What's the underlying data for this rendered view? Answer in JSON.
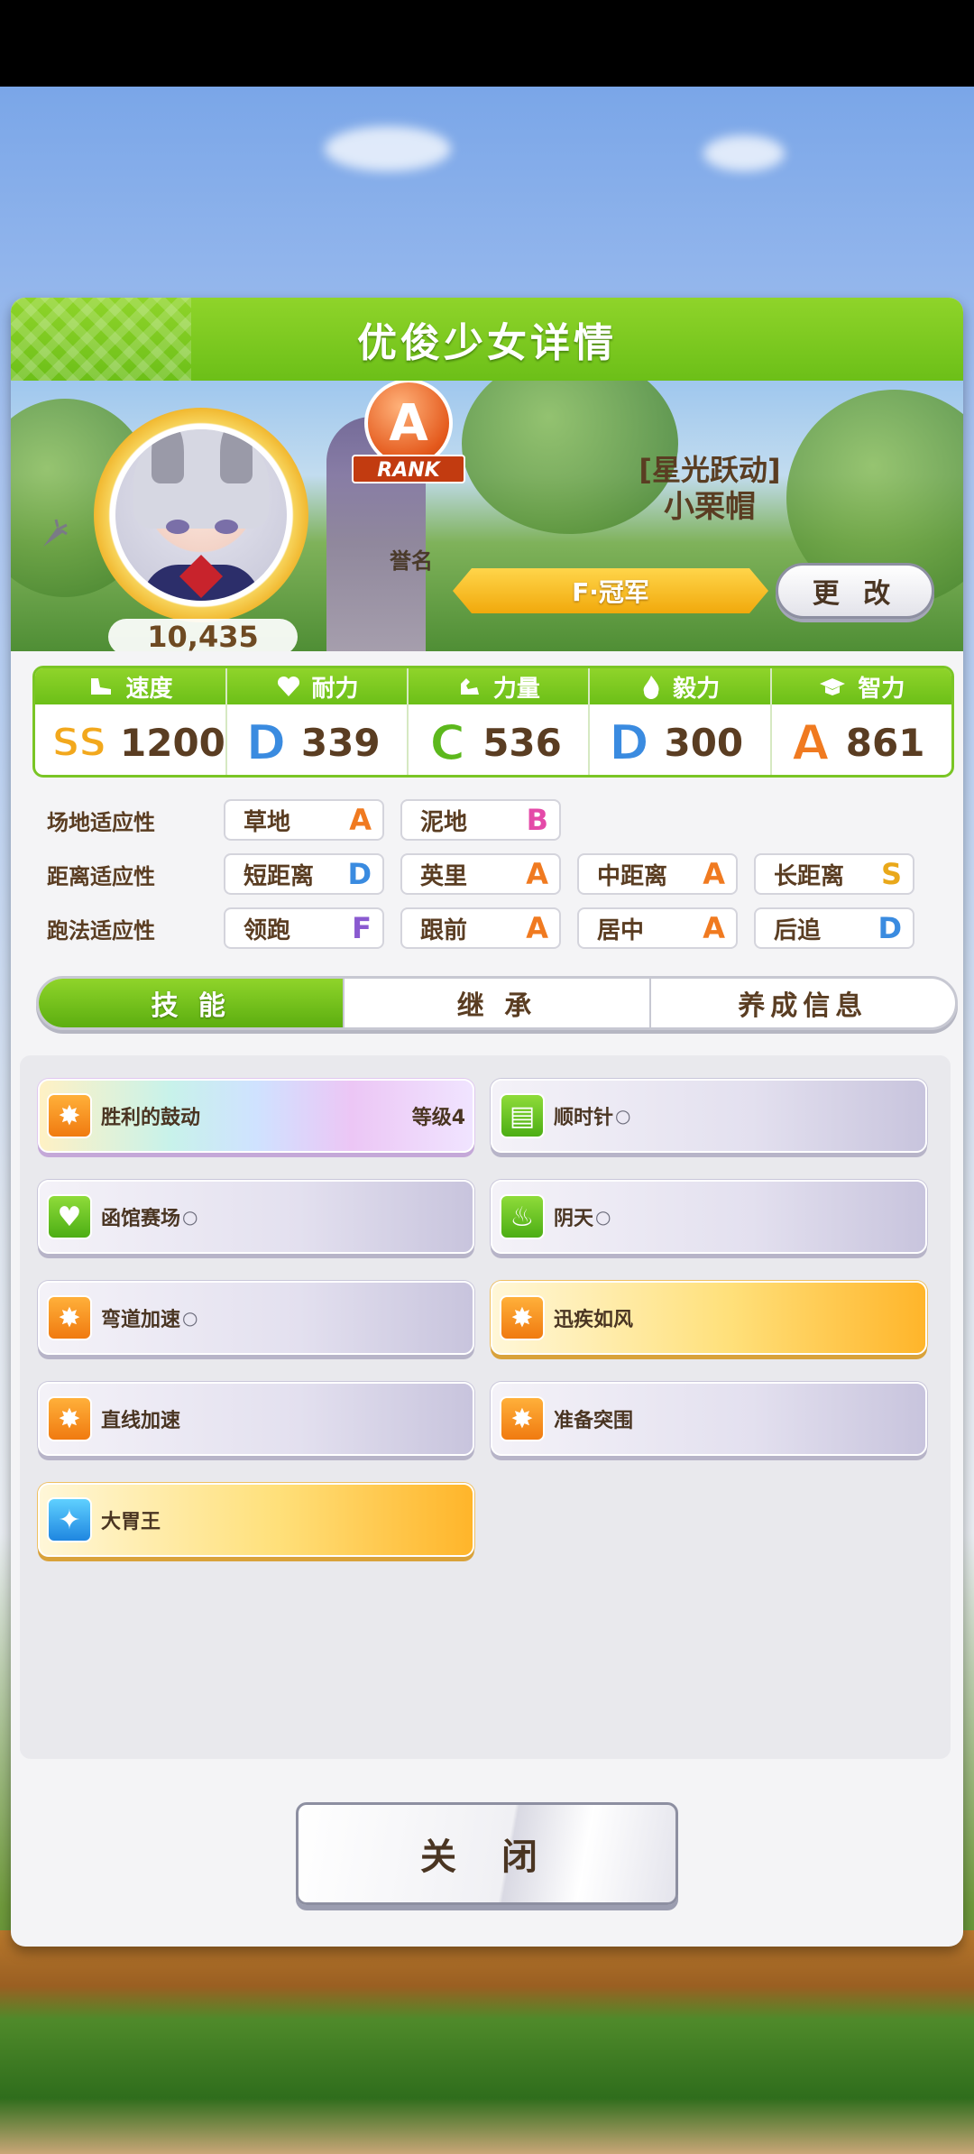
{
  "panel": {
    "title": "优俊少女详情"
  },
  "character": {
    "fans": "10,435",
    "outfit": "[星光跃动]",
    "name": "小栗帽",
    "rank_letter": "A",
    "rank_ribbon": "RANK",
    "rank_caption": "誉名",
    "title": "F·冠军",
    "change_button": "更 改"
  },
  "stats": [
    {
      "name": "速度",
      "grade": "SS",
      "grade_color": "#f2a81d",
      "value": "1200",
      "icon": "shoe-icon"
    },
    {
      "name": "耐力",
      "grade": "D",
      "grade_color": "#3a8be0",
      "value": "339",
      "icon": "heart-icon"
    },
    {
      "name": "力量",
      "grade": "C",
      "grade_color": "#5cb81c",
      "value": "536",
      "icon": "arm-icon"
    },
    {
      "name": "毅力",
      "grade": "D",
      "grade_color": "#3a8be0",
      "value": "300",
      "icon": "flame-icon"
    },
    {
      "name": "智力",
      "grade": "A",
      "grade_color": "#f07a20",
      "value": "861",
      "icon": "cap-icon"
    }
  ],
  "aptitudes": [
    {
      "label": "场地适应性",
      "items": [
        {
          "name": "草地",
          "grade": "A",
          "color": "#f07a20"
        },
        {
          "name": "泥地",
          "grade": "B",
          "color": "#e44aa8"
        }
      ]
    },
    {
      "label": "距离适应性",
      "items": [
        {
          "name": "短距离",
          "grade": "D",
          "color": "#3a8be0"
        },
        {
          "name": "英里",
          "grade": "A",
          "color": "#f07a20"
        },
        {
          "name": "中距离",
          "grade": "A",
          "color": "#f07a20"
        },
        {
          "name": "长距离",
          "grade": "S",
          "color": "#e9a81a"
        }
      ]
    },
    {
      "label": "跑法适应性",
      "items": [
        {
          "name": "领跑",
          "grade": "F",
          "color": "#8a5ad0"
        },
        {
          "name": "跟前",
          "grade": "A",
          "color": "#f07a20"
        },
        {
          "name": "居中",
          "grade": "A",
          "color": "#f07a20"
        },
        {
          "name": "后追",
          "grade": "D",
          "color": "#3a8be0"
        }
      ]
    }
  ],
  "tabs": {
    "skills": "技 能",
    "inherit": "继 承",
    "training": "养成信息"
  },
  "skills": [
    {
      "name": "胜利的鼓动",
      "level": "等级4",
      "style": "rainbow",
      "icon": "orange",
      "hint": ""
    },
    {
      "name": "顺时针",
      "level": "",
      "style": "normal",
      "icon": "green",
      "hint": "○"
    },
    {
      "name": "函馆赛场",
      "level": "",
      "style": "normal",
      "icon": "green",
      "hint": "○"
    },
    {
      "name": "阴天",
      "level": "",
      "style": "normal",
      "icon": "green",
      "hint": "○"
    },
    {
      "name": "弯道加速",
      "level": "",
      "style": "normal",
      "icon": "orange",
      "hint": "○"
    },
    {
      "name": "迅疾如风",
      "level": "",
      "style": "gold",
      "icon": "orange",
      "hint": ""
    },
    {
      "name": "直线加速",
      "level": "",
      "style": "normal",
      "icon": "orange",
      "hint": ""
    },
    {
      "name": "准备突围",
      "level": "",
      "style": "normal",
      "icon": "orange",
      "hint": ""
    },
    {
      "name": "大胃王",
      "level": "",
      "style": "gold",
      "icon": "blue",
      "hint": ""
    }
  ],
  "close_button": "关 闭"
}
